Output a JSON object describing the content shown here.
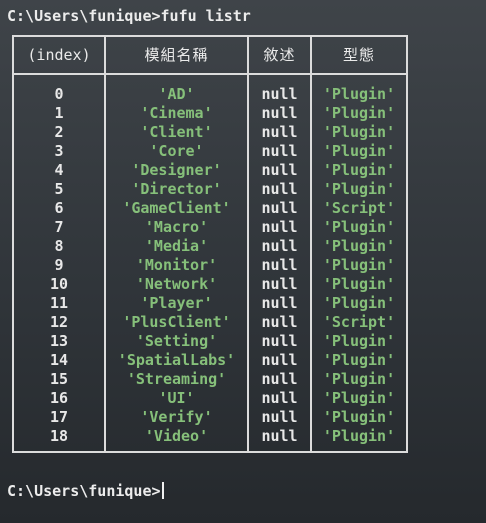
{
  "terminal": {
    "command_line": "C:\\Users\\funique>fufu listr",
    "prompt_line": "C:\\Users\\funique>"
  },
  "table": {
    "headers": {
      "index": "(index)",
      "name": "模組名稱",
      "description": "敘述",
      "type": "型態"
    },
    "rows": [
      {
        "index": "0",
        "name": "'AD'",
        "description": "null",
        "type": "'Plugin'"
      },
      {
        "index": "1",
        "name": "'Cinema'",
        "description": "null",
        "type": "'Plugin'"
      },
      {
        "index": "2",
        "name": "'Client'",
        "description": "null",
        "type": "'Plugin'"
      },
      {
        "index": "3",
        "name": "'Core'",
        "description": "null",
        "type": "'Plugin'"
      },
      {
        "index": "4",
        "name": "'Designer'",
        "description": "null",
        "type": "'Plugin'"
      },
      {
        "index": "5",
        "name": "'Director'",
        "description": "null",
        "type": "'Plugin'"
      },
      {
        "index": "6",
        "name": "'GameClient'",
        "description": "null",
        "type": "'Script'"
      },
      {
        "index": "7",
        "name": "'Macro'",
        "description": "null",
        "type": "'Plugin'"
      },
      {
        "index": "8",
        "name": "'Media'",
        "description": "null",
        "type": "'Plugin'"
      },
      {
        "index": "9",
        "name": "'Monitor'",
        "description": "null",
        "type": "'Plugin'"
      },
      {
        "index": "10",
        "name": "'Network'",
        "description": "null",
        "type": "'Plugin'"
      },
      {
        "index": "11",
        "name": "'Player'",
        "description": "null",
        "type": "'Plugin'"
      },
      {
        "index": "12",
        "name": "'PlusClient'",
        "description": "null",
        "type": "'Script'"
      },
      {
        "index": "13",
        "name": "'Setting'",
        "description": "null",
        "type": "'Plugin'"
      },
      {
        "index": "14",
        "name": "'SpatialLabs'",
        "description": "null",
        "type": "'Plugin'"
      },
      {
        "index": "15",
        "name": "'Streaming'",
        "description": "null",
        "type": "'Plugin'"
      },
      {
        "index": "16",
        "name": "'UI'",
        "description": "null",
        "type": "'Plugin'"
      },
      {
        "index": "17",
        "name": "'Verify'",
        "description": "null",
        "type": "'Plugin'"
      },
      {
        "index": "18",
        "name": "'Video'",
        "description": "null",
        "type": "'Plugin'"
      }
    ]
  },
  "colors": {
    "string_value": "#86c07a",
    "text": "#e8e8e8",
    "border": "#dcdcdc"
  }
}
